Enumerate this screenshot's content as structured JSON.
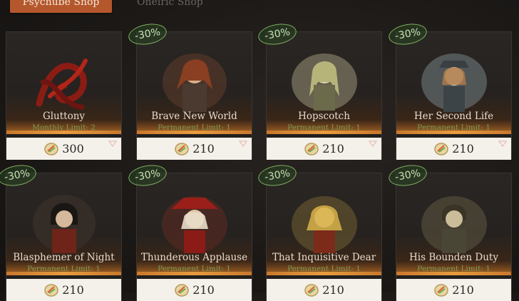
{
  "tabs": {
    "active": "Psychube Shop",
    "inactive": "Oneiric Shop"
  },
  "colors": {
    "accent": "#b5572c",
    "limit_text": "#7f9a55",
    "price_bg": "#f4f0ea"
  },
  "currency_icon": "sharpodonty-coin-icon",
  "items": [
    {
      "title": "Gluttony",
      "limit": "Monthly Limit: 2",
      "price": "300",
      "discount": ""
    },
    {
      "title": "Brave New World",
      "limit": "Permanent Limit: 1",
      "price": "210",
      "discount": "-30%"
    },
    {
      "title": "Hopscotch",
      "limit": "Permanent Limit: 1",
      "price": "210",
      "discount": "-30%"
    },
    {
      "title": "Her Second Life",
      "limit": "Permanent Limit: 1",
      "price": "210",
      "discount": "-30%"
    },
    {
      "title": "Blasphemer of Night",
      "limit": "Permanent Limit: 1",
      "price": "210",
      "discount": "-30%"
    },
    {
      "title": "Thunderous Applause",
      "limit": "Permanent Limit: 1",
      "price": "210",
      "discount": "-30%"
    },
    {
      "title": "That Inquisitive Dear",
      "limit": "Permanent Limit: 1",
      "price": "210",
      "discount": "-30%"
    },
    {
      "title": "His Bounden Duty",
      "limit": "Permanent Limit: 1",
      "price": "210",
      "discount": "-30%"
    }
  ]
}
